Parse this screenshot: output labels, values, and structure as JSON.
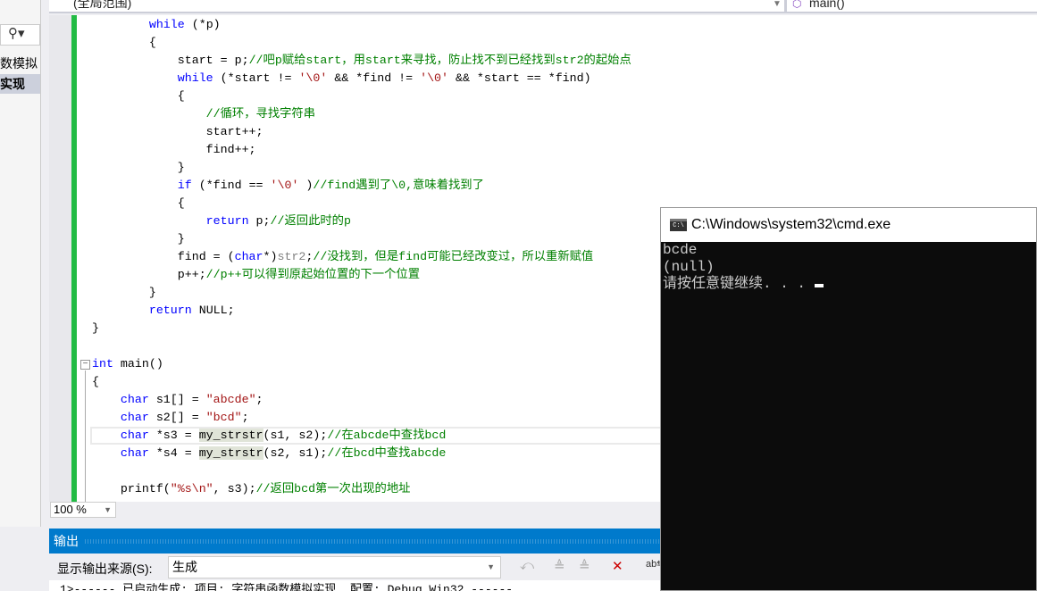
{
  "left_panel": {
    "search_icon": "search-icon",
    "items": [
      "数模拟",
      "实现"
    ]
  },
  "nav": {
    "scope": "(全局范围)",
    "function": "main()"
  },
  "code": [
    [
      [
        "",
        "        "
      ],
      [
        "kw",
        "while"
      ],
      [
        "",
        " (*p)"
      ]
    ],
    [
      [
        "",
        "        {"
      ]
    ],
    [
      [
        "",
        "            start = p;"
      ],
      [
        "cm",
        "//吧p赋给start，用start来寻找，防止找不到已经找到str2的起始点"
      ]
    ],
    [
      [
        "",
        "            "
      ],
      [
        "kw",
        "while"
      ],
      [
        "",
        " (*start != "
      ],
      [
        "str",
        "'\\0'"
      ],
      [
        "",
        " && *find != "
      ],
      [
        "str",
        "'\\0'"
      ],
      [
        "",
        " && *start == *find)"
      ]
    ],
    [
      [
        "",
        "            {"
      ]
    ],
    [
      [
        "",
        "                "
      ],
      [
        "cm",
        "//循环，寻找字符串"
      ]
    ],
    [
      [
        "",
        "                start++;"
      ]
    ],
    [
      [
        "",
        "                find++;"
      ]
    ],
    [
      [
        "",
        "            }"
      ]
    ],
    [
      [
        "",
        "            "
      ],
      [
        "kw",
        "if"
      ],
      [
        "",
        " (*find == "
      ],
      [
        "str",
        "'\\0'"
      ],
      [
        "",
        " )"
      ],
      [
        "cm",
        "//find遇到了\\0,意味着找到了"
      ]
    ],
    [
      [
        "",
        "            {"
      ]
    ],
    [
      [
        "",
        "                "
      ],
      [
        "kw",
        "return"
      ],
      [
        "",
        " p;"
      ],
      [
        "cm",
        "//返回此时的p"
      ]
    ],
    [
      [
        "",
        "            }"
      ]
    ],
    [
      [
        "",
        "            find = ("
      ],
      [
        "kw",
        "char"
      ],
      [
        "",
        "*)"
      ],
      [
        "gray",
        "str2"
      ],
      [
        "",
        ";"
      ],
      [
        "cm",
        "//没找到，但是find可能已经改变过，所以重新赋值"
      ]
    ],
    [
      [
        "",
        "            p++;"
      ],
      [
        "cm",
        "//p++可以得到原起始位置的下一个位置"
      ]
    ],
    [
      [
        "",
        "        }"
      ]
    ],
    [
      [
        "",
        "        "
      ],
      [
        "kw",
        "return"
      ],
      [
        "",
        " NULL;"
      ]
    ],
    [
      [
        "",
        "}"
      ]
    ],
    [
      [
        "",
        ""
      ]
    ],
    [
      [
        "kw",
        "int"
      ],
      [
        "",
        " main()"
      ]
    ],
    [
      [
        "",
        "{"
      ]
    ],
    [
      [
        "",
        "    "
      ],
      [
        "kw",
        "char"
      ],
      [
        "",
        " s1[] = "
      ],
      [
        "str",
        "\"abcde\""
      ],
      [
        "",
        ";"
      ]
    ],
    [
      [
        "",
        "    "
      ],
      [
        "kw",
        "char"
      ],
      [
        "",
        " s2[] = "
      ],
      [
        "str",
        "\"bcd\""
      ],
      [
        "",
        ";"
      ]
    ],
    [
      [
        "",
        "    "
      ],
      [
        "kw",
        "char"
      ],
      [
        "",
        " *s3 = "
      ],
      [
        "fnhl",
        "my_strstr"
      ],
      [
        "",
        "(s1, s2);"
      ],
      [
        "cm",
        "//在abcde中查找bcd"
      ]
    ],
    [
      [
        "",
        "    "
      ],
      [
        "kw",
        "char"
      ],
      [
        "",
        " *s4 = "
      ],
      [
        "fnhl",
        "my_strstr"
      ],
      [
        "",
        "(s2, s1);"
      ],
      [
        "cm",
        "//在bcd中查找abcde"
      ]
    ],
    [
      [
        "",
        ""
      ]
    ],
    [
      [
        "",
        "    printf("
      ],
      [
        "str",
        "\"%s\\n\""
      ],
      [
        "",
        ", s3);"
      ],
      [
        "cm",
        "//返回bcd第一次出现的地址"
      ]
    ]
  ],
  "current_line": 23,
  "zoom": "100 %",
  "output": {
    "title": "输出",
    "source_label": "显示输出来源(S):",
    "source_value": "生成",
    "text": "1>------ 已启动生成: 项目: 字符串函数模拟实现, 配置: Debug Win32 ------"
  },
  "cmd": {
    "title": "C:\\Windows\\system32\\cmd.exe",
    "lines": [
      "bcde",
      "(null)",
      "请按任意键继续. . . "
    ]
  },
  "colors": {
    "accent": "#007acc",
    "keyword": "#0000ff",
    "string": "#a31515",
    "comment": "#008000",
    "console_bg": "#0c0c0c"
  }
}
